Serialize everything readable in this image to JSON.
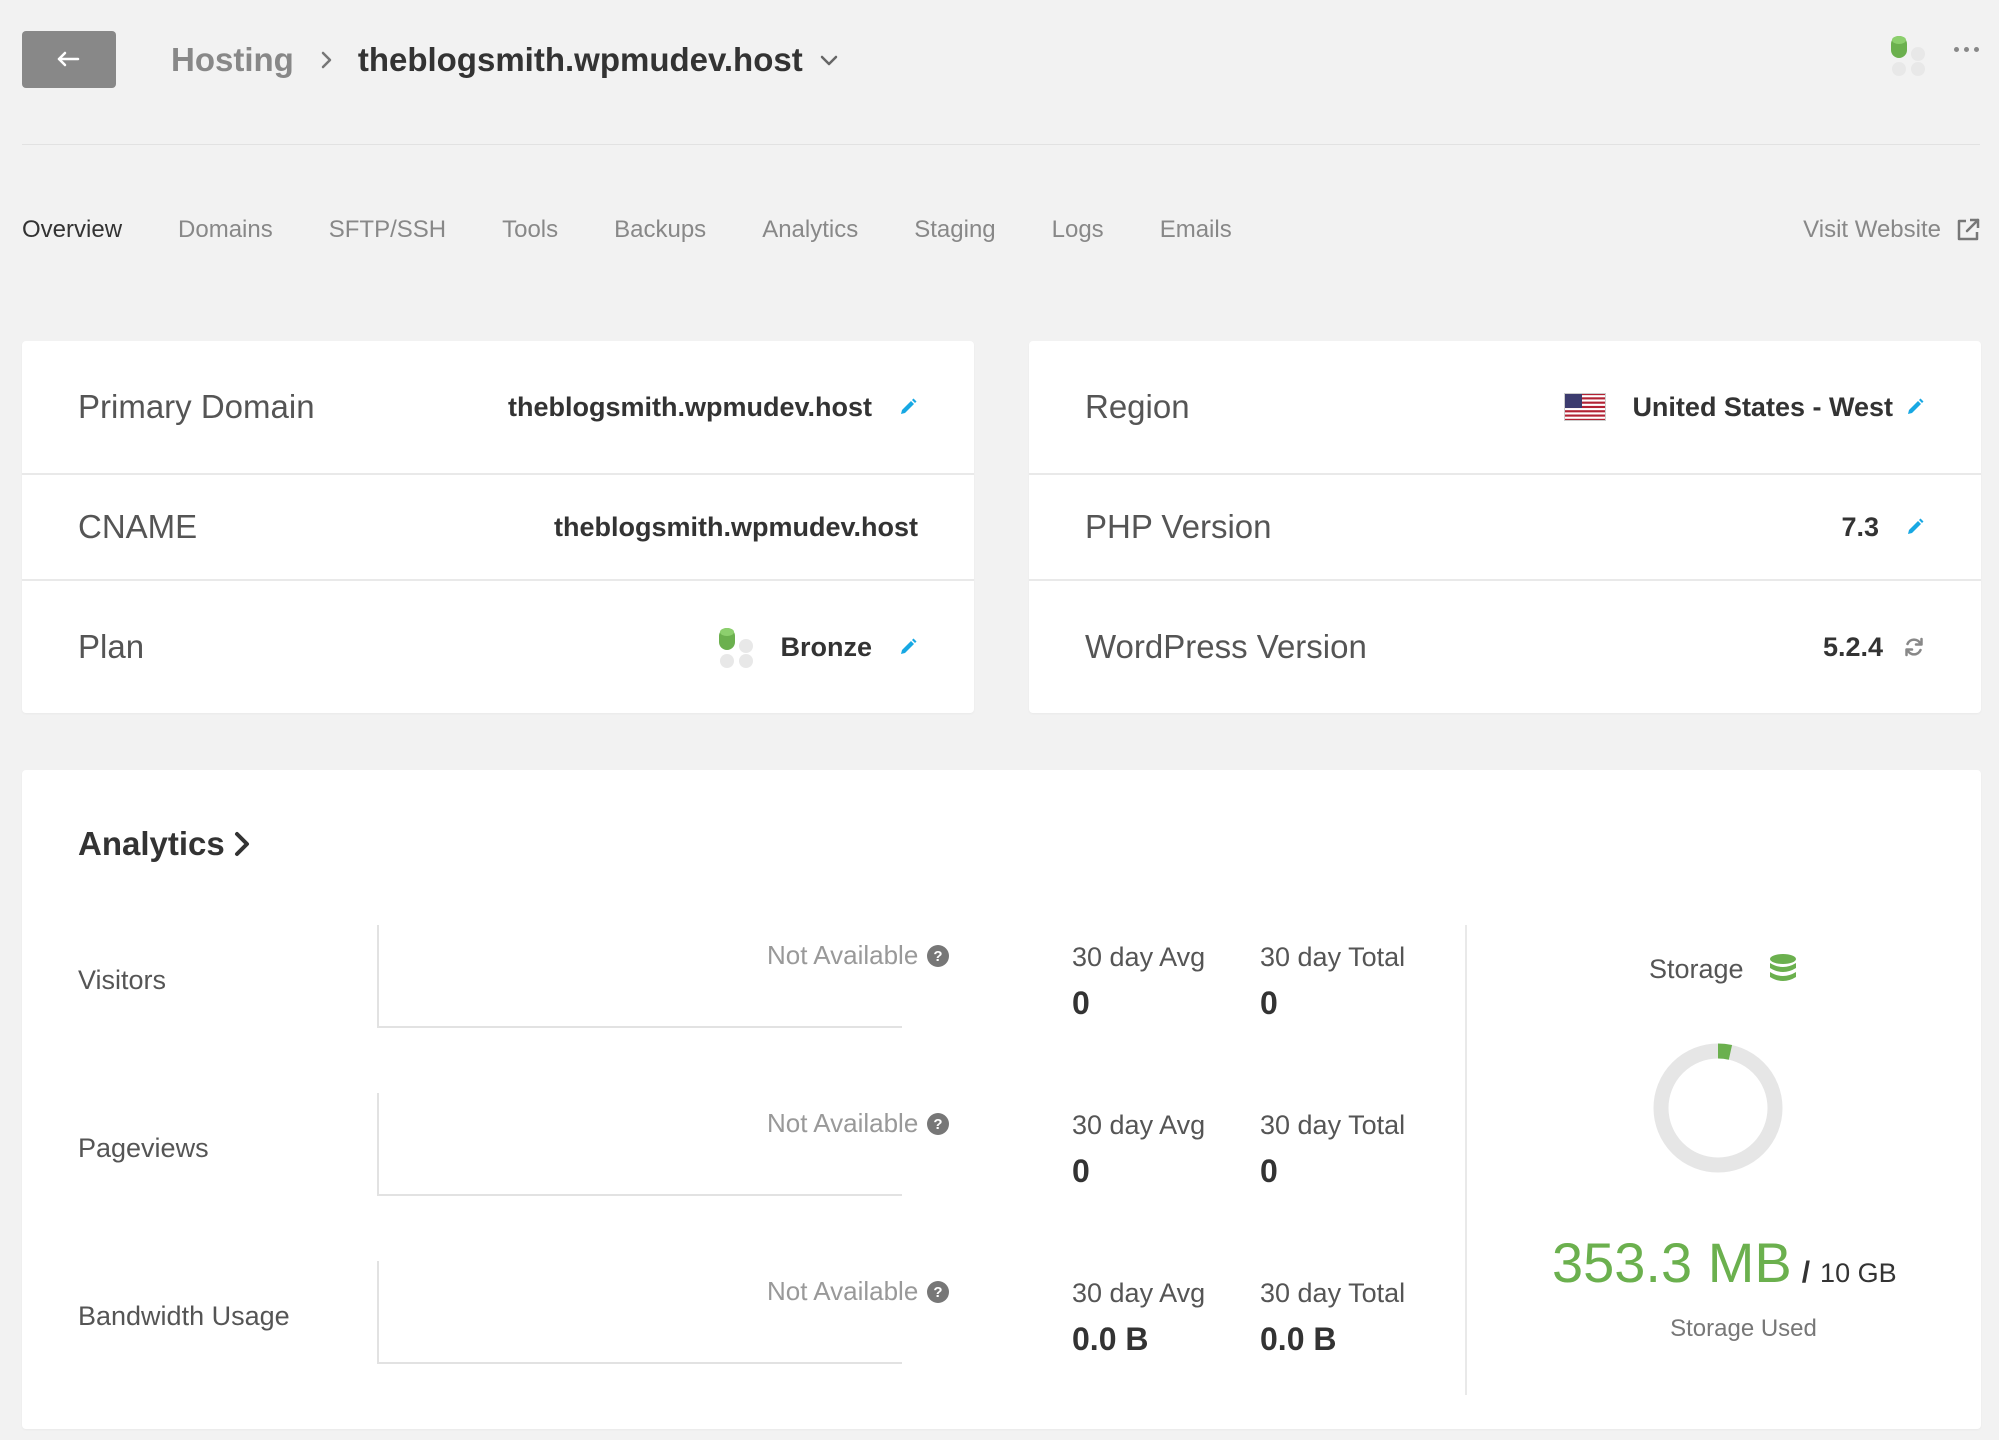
{
  "header": {
    "breadcrumb_root": "Hosting",
    "site_name": "theblogsmith.wpmudev.host"
  },
  "tabs": [
    {
      "label": "Overview",
      "active": true
    },
    {
      "label": "Domains"
    },
    {
      "label": "SFTP/SSH"
    },
    {
      "label": "Tools"
    },
    {
      "label": "Backups"
    },
    {
      "label": "Analytics"
    },
    {
      "label": "Staging"
    },
    {
      "label": "Logs"
    },
    {
      "label": "Emails"
    }
  ],
  "visit_website": "Visit Website",
  "site_info": {
    "primary_domain": {
      "label": "Primary Domain",
      "value": "theblogsmith.wpmudev.host"
    },
    "cname": {
      "label": "CNAME",
      "value": "theblogsmith.wpmudev.host"
    },
    "plan": {
      "label": "Plan",
      "value": "Bronze"
    }
  },
  "server_info": {
    "region": {
      "label": "Region",
      "value": "United States - West"
    },
    "php": {
      "label": "PHP Version",
      "value": "7.3"
    },
    "wordpress": {
      "label": "WordPress Version",
      "value": "5.2.4"
    }
  },
  "analytics": {
    "title": "Analytics",
    "metrics": [
      {
        "label": "Visitors",
        "status": "Not Available",
        "avg_label": "30 day Avg",
        "avg": "0",
        "total_label": "30 day Total",
        "total": "0"
      },
      {
        "label": "Pageviews",
        "status": "Not Available",
        "avg_label": "30 day Avg",
        "avg": "0",
        "total_label": "30 day Total",
        "total": "0"
      },
      {
        "label": "Bandwidth Usage",
        "status": "Not Available",
        "avg_label": "30 day Avg",
        "avg": "0.0 B",
        "total_label": "30 day Total",
        "total": "0.0 B"
      }
    ]
  },
  "storage": {
    "label": "Storage",
    "used": "353.3 MB",
    "total": "10 GB",
    "used_fraction": 0.035,
    "caption": "Storage Used"
  },
  "colors": {
    "accent_green": "#6bb04e",
    "edit_blue": "#17a8e3",
    "back_button": "#888888"
  },
  "icons": [
    "back-arrow-icon",
    "chevron-right-icon",
    "chevron-down-icon",
    "plan-icon",
    "more-icon",
    "external-link-icon",
    "pencil-icon",
    "us-flag-icon",
    "refresh-icon",
    "help-icon",
    "database-icon"
  ]
}
